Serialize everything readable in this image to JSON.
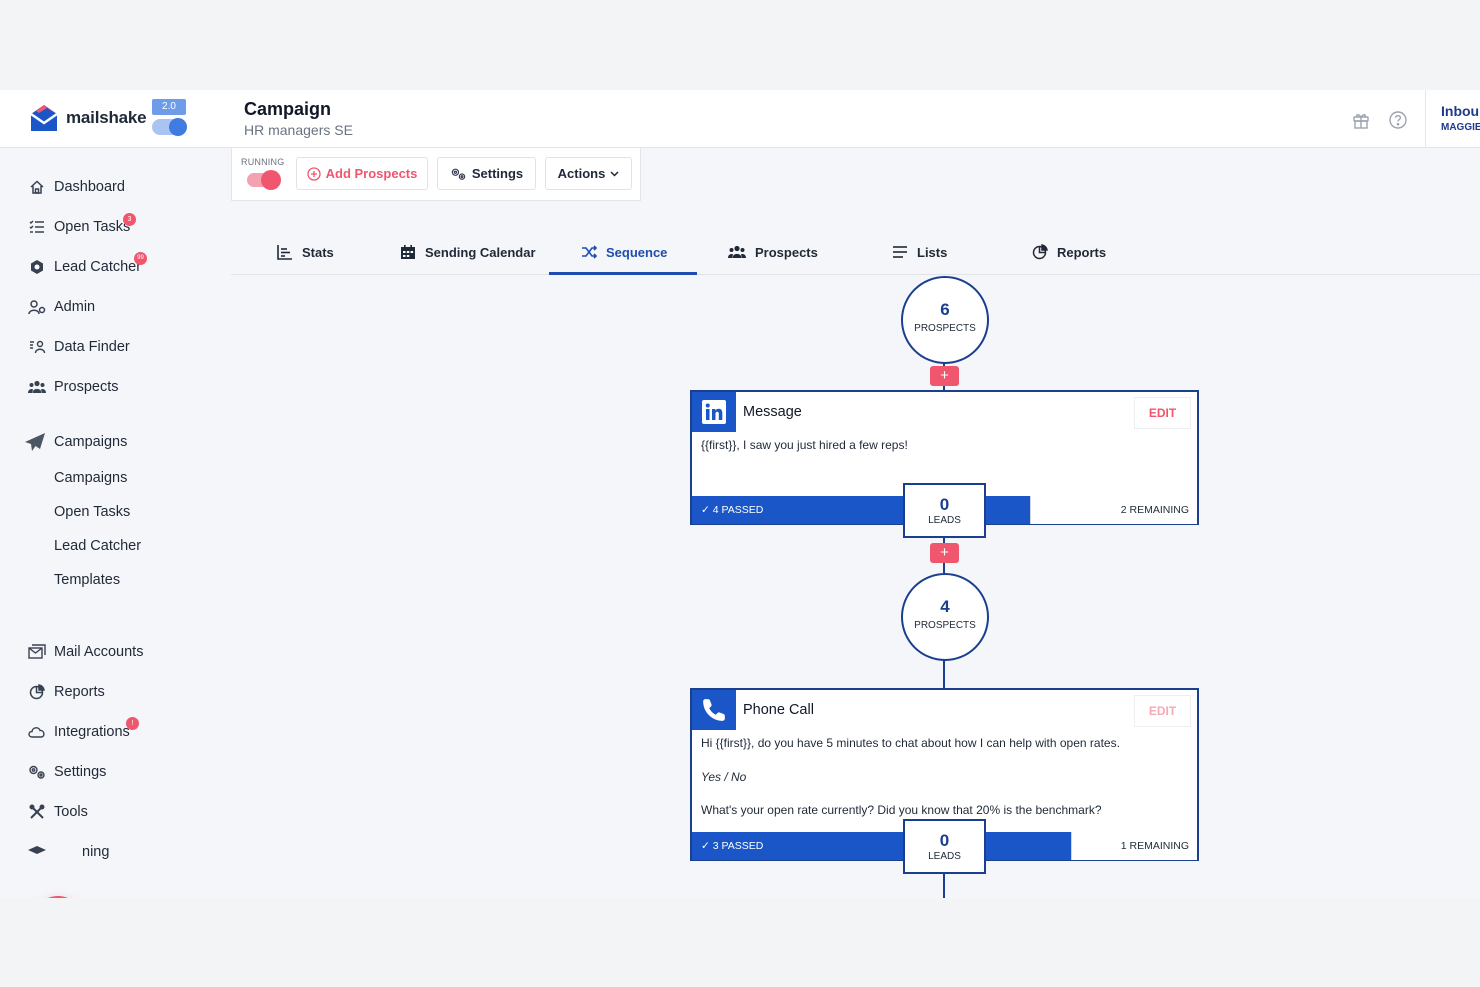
{
  "brand": {
    "name": "mailshake",
    "version": "2.0"
  },
  "campaign": {
    "title": "Campaign",
    "subtitle": "HR managers SE"
  },
  "account": {
    "title": "Inbound",
    "subtitle": "MAGGIE"
  },
  "sidebar": {
    "items": [
      {
        "label": "Dashboard",
        "icon": "home-icon"
      },
      {
        "label": "Open Tasks",
        "icon": "task-list-icon",
        "badge": "3"
      },
      {
        "label": "Lead Catcher",
        "icon": "lead-catcher-icon",
        "badge": "99"
      },
      {
        "label": "Admin",
        "icon": "admin-icon"
      },
      {
        "label": "Data Finder",
        "icon": "data-finder-icon"
      },
      {
        "label": "Prospects",
        "icon": "people-icon"
      },
      {
        "label": "Campaigns",
        "icon": "paper-plane-icon"
      }
    ],
    "sub_items": [
      "Campaigns",
      "Open Tasks",
      "Lead Catcher",
      "Templates"
    ],
    "bottom_items": [
      {
        "label": "Mail Accounts",
        "icon": "mail-accounts-icon"
      },
      {
        "label": "Reports",
        "icon": "reports-icon"
      },
      {
        "label": "Integrations",
        "icon": "cloud-icon",
        "badge": "!"
      },
      {
        "label": "Settings",
        "icon": "gears-icon"
      },
      {
        "label": "Tools",
        "icon": "tools-icon"
      },
      {
        "label": "ning",
        "icon": "training-icon"
      }
    ],
    "fab": "+"
  },
  "actionbar": {
    "status": "RUNNING",
    "add": "Add Prospects",
    "settings": "Settings",
    "actions": "Actions"
  },
  "tabs": [
    {
      "label": "Stats",
      "icon": "stats-icon"
    },
    {
      "label": "Sending Calendar",
      "icon": "calendar-icon"
    },
    {
      "label": "Sequence",
      "icon": "shuffle-icon",
      "active": true
    },
    {
      "label": "Prospects",
      "icon": "people-icon"
    },
    {
      "label": "Lists",
      "icon": "list-icon"
    },
    {
      "label": "Reports",
      "icon": "reports-icon"
    }
  ],
  "sequence": {
    "nodes": [
      {
        "count": "6",
        "label": "PROSPECTS"
      },
      {
        "count": "4",
        "label": "PROSPECTS"
      }
    ],
    "plus": "+",
    "steps": [
      {
        "type": "Message",
        "icon": "linkedin-icon",
        "edit": "EDIT",
        "body": [
          "{{first}}, I saw you just hired a few reps!"
        ],
        "passed": "4 PASSED",
        "remaining": "2 REMAINING",
        "leads": {
          "count": "0",
          "label": "LEADS"
        }
      },
      {
        "type": "Phone Call",
        "icon": "phone-icon",
        "edit": "EDIT",
        "body": [
          "Hi {{first}}, do you have 5 minutes to chat about how I can help with open rates.",
          "Yes / No",
          "What's your open rate currently? Did you know that 20% is the benchmark?"
        ],
        "passed": "3 PASSED",
        "remaining": "1 REMAINING",
        "leads": {
          "count": "0",
          "label": "LEADS"
        }
      }
    ]
  },
  "colors": {
    "accent": "#f0566e",
    "primary": "#1a56c7",
    "navy": "#1a3f8f"
  }
}
